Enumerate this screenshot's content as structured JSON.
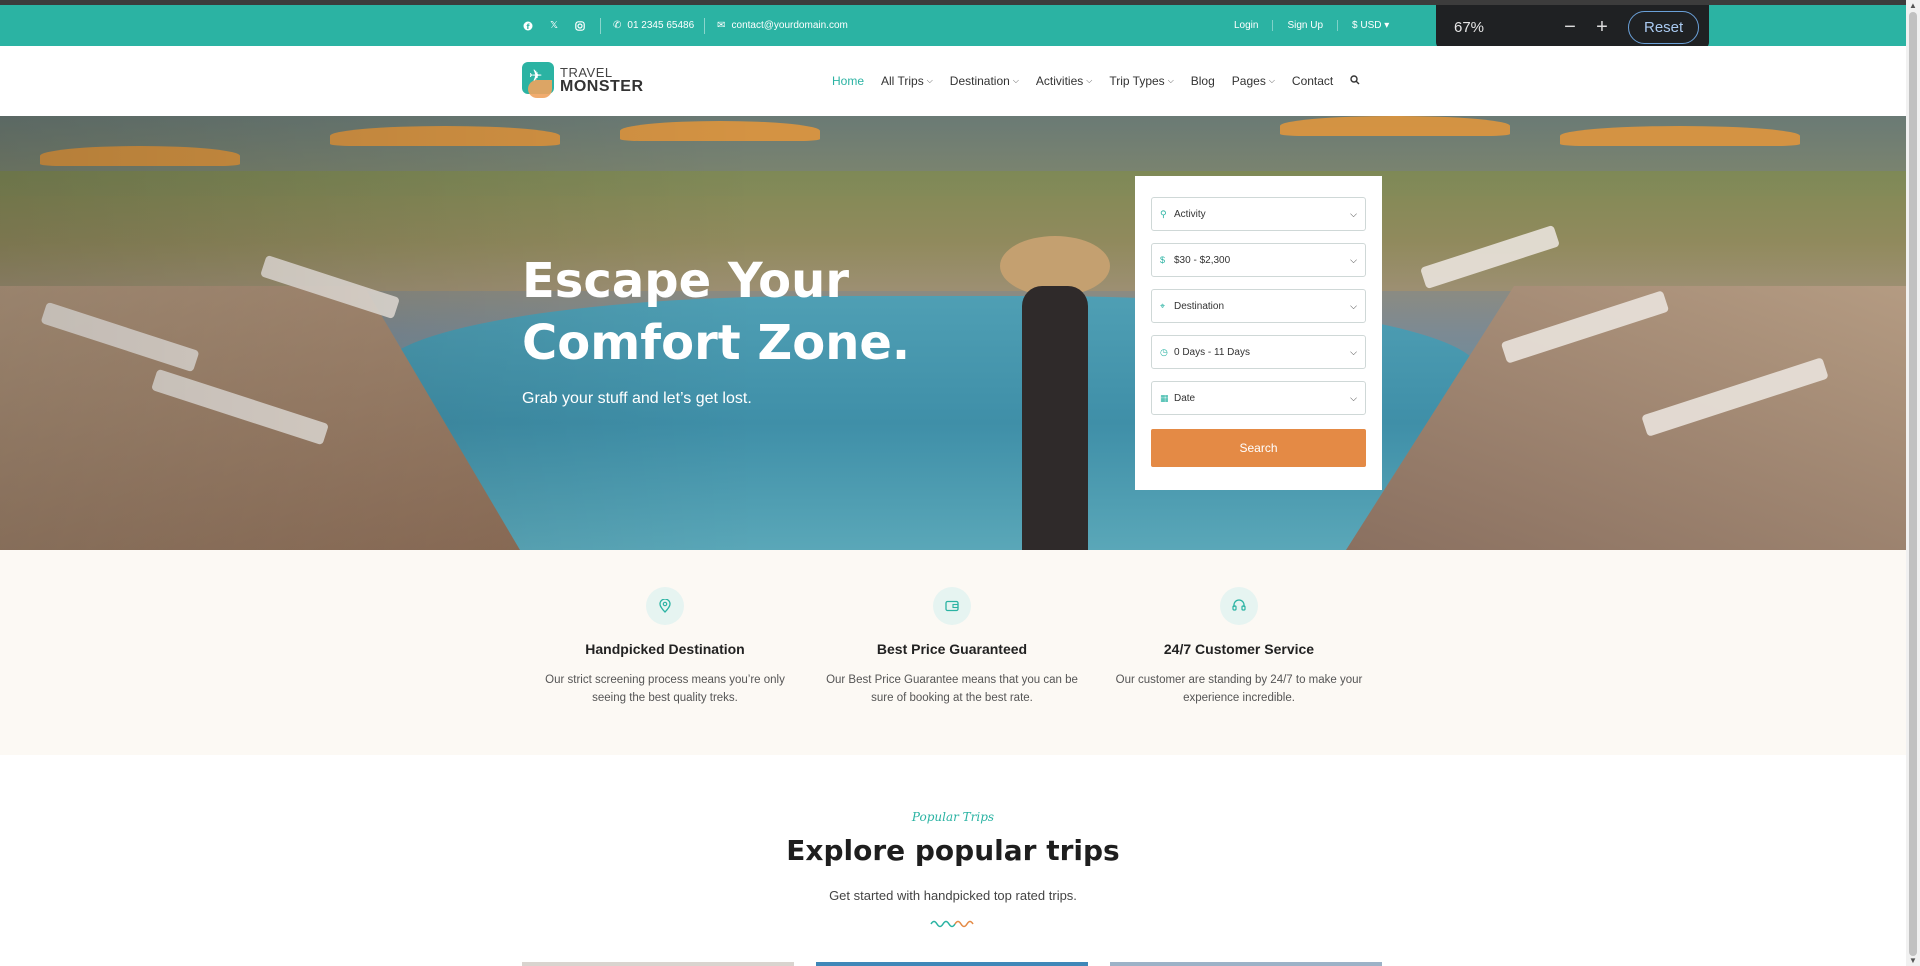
{
  "topbar": {
    "phone": "01 2345 65486",
    "email": "contact@yourdomain.com",
    "login": "Login",
    "signup": "Sign Up",
    "currency": "$ USD"
  },
  "zoom": {
    "level": "67%",
    "minus": "−",
    "plus": "+",
    "reset": "Reset"
  },
  "logo": {
    "line1": "TRAVEL",
    "line2": "MONSTER"
  },
  "nav": {
    "home": "Home",
    "all_trips": "All Trips",
    "destination": "Destination",
    "activities": "Activities",
    "trip_types": "Trip Types",
    "blog": "Blog",
    "pages": "Pages",
    "contact": "Contact"
  },
  "hero": {
    "title_line1": "Escape Your",
    "title_line2": "Comfort Zone.",
    "subtitle": "Grab your stuff and let’s get lost."
  },
  "search_form": {
    "activity": "Activity",
    "price": "$30 - $2,300",
    "destination": "Destination",
    "duration": "0 Days - 11 Days",
    "date": "Date",
    "button": "Search"
  },
  "features": [
    {
      "title": "Handpicked Destination",
      "desc_line1": "Our strict screening process means you’re only",
      "desc_line2": "seeing the best quality treks."
    },
    {
      "title": "Best Price Guaranteed",
      "desc_line1": "Our Best Price Guarantee means that you can be",
      "desc_line2": "sure of booking at the best rate."
    },
    {
      "title": "24/7 Customer Service",
      "desc_line1": "Our customer are standing by 24/7 to make your",
      "desc_line2": "experience incredible."
    }
  ],
  "popular": {
    "eyebrow": "Popular Trips",
    "title": "Explore popular trips",
    "subtitle": "Get started with handpicked top rated trips."
  },
  "colors": {
    "brand_teal": "#2bb3a3",
    "accent_orange": "#e48a45"
  }
}
